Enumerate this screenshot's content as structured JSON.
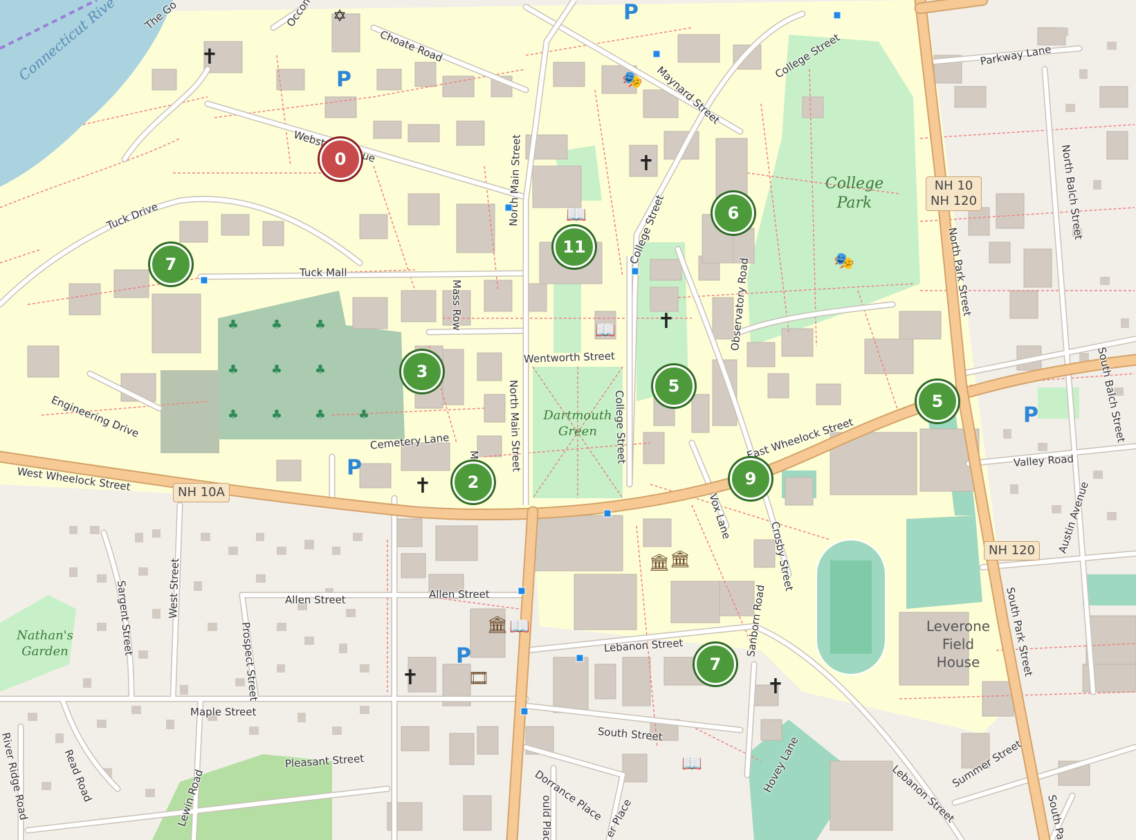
{
  "map": {
    "markers": [
      {
        "label": "0",
        "kind": "selected"
      },
      {
        "label": "7",
        "kind": "cluster"
      },
      {
        "label": "11",
        "kind": "cluster"
      },
      {
        "label": "6",
        "kind": "cluster"
      },
      {
        "label": "3",
        "kind": "cluster"
      },
      {
        "label": "5",
        "kind": "cluster"
      },
      {
        "label": "5",
        "kind": "cluster"
      },
      {
        "label": "2",
        "kind": "cluster"
      },
      {
        "label": "9",
        "kind": "cluster"
      },
      {
        "label": "7",
        "kind": "cluster"
      }
    ],
    "streets": {
      "the_gorge": "The Go",
      "occom": "Occom",
      "choate_road": "Choate Road",
      "maynard_street": "Maynard Street",
      "college_street_north": "College Street",
      "parkway_lane": "Parkway Lane",
      "webster_avenue": "Webster Avenue",
      "north_main_street_upper": "North Main Street",
      "tuck_drive": "Tuck Drive",
      "tuck_mall": "Tuck Mall",
      "mass_row": "Mass Row",
      "college_street_mid": "College Street",
      "observatory_road": "Observatory Road",
      "north_park_street": "North Park Street",
      "north_balch_street": "North Balch Street",
      "wentworth_street": "Wentworth Street",
      "engineering_drive": "Engineering Drive",
      "cemetery_lane": "Cemetery Lane",
      "north_main_street_lower": "North Main Street",
      "college_street_lower": "College Street",
      "west_wheelock_street": "West Wheelock Street",
      "east_wheelock_street": "East Wheelock Street",
      "south_balch_street": "South Balch Street",
      "valley_road": "Valley Road",
      "vox_lane": "Vox Lane",
      "crosby_street": "Crosby Street",
      "austin_avenue": "Austin Avenue",
      "sargent_street": "Sargent Street",
      "west_street": "West Street",
      "allen_street_west": "Allen Street",
      "allen_street_east": "Allen Street",
      "prospect_street": "Prospect Street",
      "lebanon_street_upper": "Lebanon Street",
      "sanborn_road": "Sanborn Road",
      "south_park_street": "South Park Street",
      "maple_street": "Maple Street",
      "south_street": "South Street",
      "read_road": "Read Road",
      "river_ridge_road": "River Ridge Road",
      "pleasant_street": "Pleasant Street",
      "lewin_road": "Lewin Road",
      "dorrance_place": "Dorrance Place",
      "hovey_lane": "Hovey Lane",
      "lebanon_street_lower": "Lebanon Street",
      "summer_street": "Summer Street",
      "south_park_lower": "South Pa",
      "mass_row_south": "Ma",
      "x_place": "er Place",
      "could_place": "ould Place"
    },
    "shields": {
      "nh10a": "NH 10A",
      "nh10_120_line1": "NH 10",
      "nh10_120_line2": "NH 120",
      "nh120": "NH 120"
    },
    "places": {
      "college_park_line1": "College",
      "college_park_line2": "Park",
      "dartmouth_green_line1": "Dartmouth",
      "dartmouth_green_line2": "Green",
      "nathans_garden_line1": "Nathan's",
      "nathans_garden_line2": "Garden",
      "leverone_line1": "Leverone",
      "leverone_line2": "Field",
      "leverone_line3": "House",
      "connecticut_river": "Connecticut Rive"
    },
    "parking_symbol": "P",
    "colors": {
      "marker_cluster": "#4c9a3a",
      "marker_selected": "#c84a4a",
      "major_road": "#f2c894",
      "park": "#c8f0c8",
      "campus": "#fefed6",
      "building": "#d3cbc2",
      "water": "#aad3df"
    }
  }
}
